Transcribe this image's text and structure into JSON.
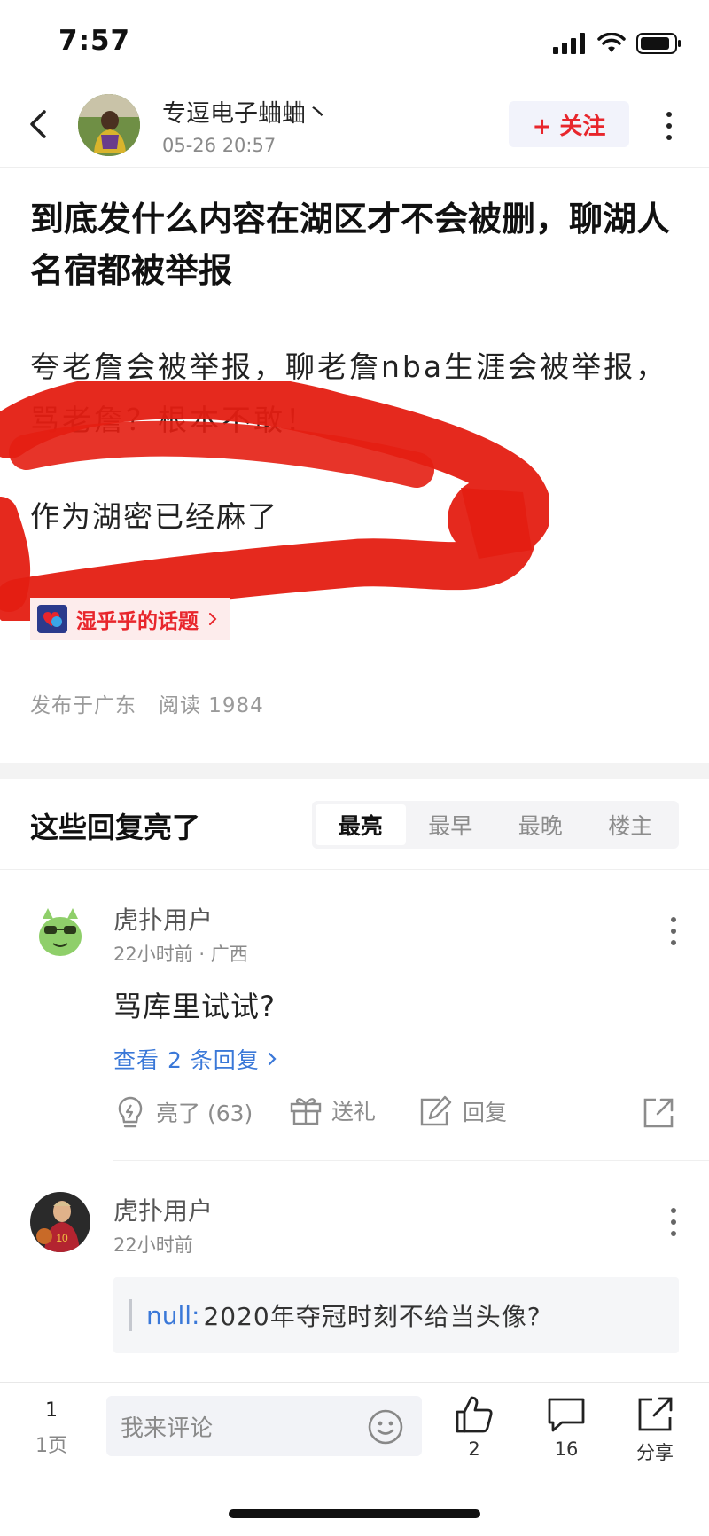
{
  "status_bar": {
    "time": "7:57"
  },
  "header": {
    "author": "专逗电子蛐蛐丶",
    "post_time": "05-26 20:57",
    "follow_label": "+ 关注"
  },
  "post": {
    "title": "到底发什么内容在湖区才不会被删，聊湖人名宿都被举报",
    "body_line1": "夸老詹会被举报，聊老詹nba生涯会被举报，骂老詹？根本不敢！",
    "body_line2": "作为湖密已经麻了",
    "topic_label": "湿乎乎的话题",
    "meta_location": "发布于广东",
    "meta_reads": "阅读 1984"
  },
  "replies": {
    "title": "这些回复亮了",
    "sort_tabs": [
      {
        "label": "最亮",
        "active": true
      },
      {
        "label": "最早",
        "active": false
      },
      {
        "label": "最晚",
        "active": false
      },
      {
        "label": "楼主",
        "active": false
      }
    ],
    "comments": [
      {
        "user": "虎扑用户",
        "time": "22小时前 · 广西",
        "text": "骂库里试试?",
        "view_replies": "查看 2 条回复",
        "light_label": "亮了 (63)",
        "gift_label": "送礼",
        "reply_label": "回复"
      },
      {
        "user": "虎扑用户",
        "time": "22小时前",
        "quote_user": "null:",
        "quote_text": "2020年夺冠时刻不给当头像?"
      }
    ]
  },
  "bottom_bar": {
    "page_num": "1",
    "page_label": "1页",
    "comment_placeholder": "我来评论",
    "like_count": "2",
    "comment_count": "16",
    "share_label": "分享"
  },
  "colors": {
    "accent_red": "#e8262c",
    "link_blue": "#3a78d8",
    "scribble_red": "#e41e12"
  }
}
